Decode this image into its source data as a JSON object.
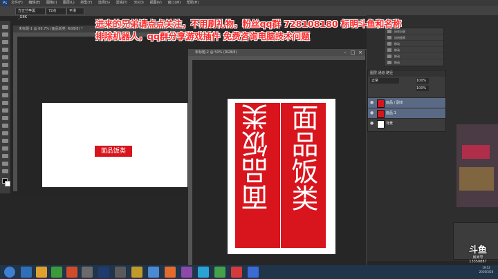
{
  "app": {
    "logo": "Ps"
  },
  "menubar": {
    "items": [
      "文件(F)",
      "编辑(E)",
      "图像(I)",
      "图层(L)",
      "类型(Y)",
      "选择(S)",
      "滤镜(T)",
      "3D(D)",
      "视图(V)",
      "窗口(W)",
      "帮助(H)"
    ]
  },
  "options": {
    "font": "方正兰亭黑_GBK",
    "size": "72点",
    "style": "平滑"
  },
  "doc1": {
    "tab": "未标题-1 @ 66.7% (面品饭类, RGB/8) *",
    "label": "面品饭类"
  },
  "doc2": {
    "title": "未标题-2 @ 50% (RGB/8)",
    "left_text": "面品饭类",
    "right_text": "面品饭类"
  },
  "overlay": {
    "line1": "进来的兄弟请点点关注，不用刷礼物，粉丝qq群 728108180 标明斗鱼和名称",
    "line2": "排除机器人，qq群分享游戏插件 免费咨询电脑技术问题"
  },
  "history": {
    "items": [
      "历史记录",
      "自由变换",
      "移动",
      "移动",
      "移动",
      "移动"
    ]
  },
  "layers": {
    "tabs": "图层  通道  路径",
    "mode": "正常",
    "opacity": "100%",
    "fill": "100%",
    "rows": [
      {
        "name": "面品 / 副本",
        "selected": true
      },
      {
        "name": "面品 1",
        "selected": true
      },
      {
        "name": "背景",
        "selected": false
      }
    ]
  },
  "watermark": {
    "brand": "斗鱼",
    "sub": "房间号",
    "room": "13350887"
  },
  "clock": {
    "time": "19:52",
    "date": "2016/3/26"
  },
  "colors": {
    "accent_red": "#d8141d",
    "caption_red": "#ff2a2a",
    "taskbar": "#20344a"
  }
}
